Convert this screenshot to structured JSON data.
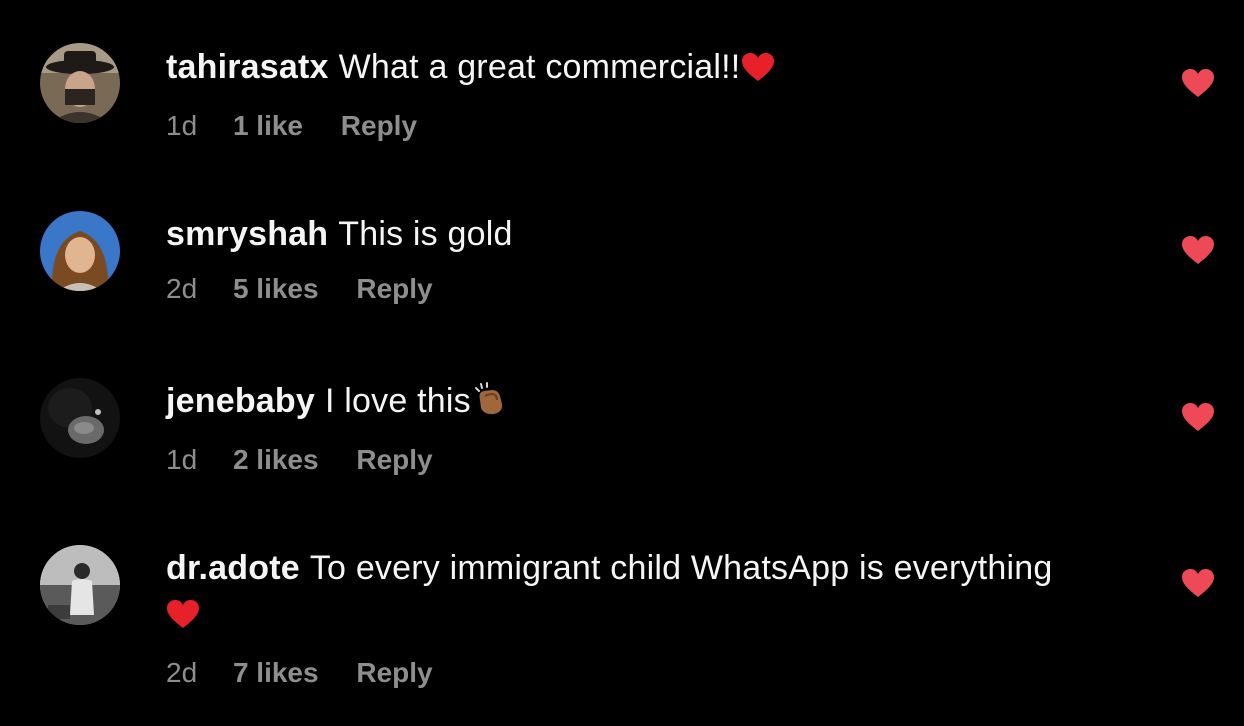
{
  "colors": {
    "background": "#000000",
    "text": "#f5f5f5",
    "meta": "#8e8e8e",
    "heart": "#ed4956"
  },
  "comments": [
    {
      "username": "tahirasatx",
      "text": "What a great commercial!!",
      "trailing_emoji": "red-heart",
      "time": "1d",
      "likes": "1 like",
      "reply": "Reply",
      "liked": true
    },
    {
      "username": "smryshah",
      "text": "This is gold",
      "time": "2d",
      "likes": "5 likes",
      "reply": "Reply",
      "liked": true
    },
    {
      "username": "jenebaby",
      "text": "I love this",
      "trailing_emoji": "clapping-hands",
      "time": "1d",
      "likes": "2 likes",
      "reply": "Reply",
      "liked": true
    },
    {
      "username": "dr.adote",
      "text": "To every immigrant child WhatsApp is everything",
      "trailing_emoji": "red-heart",
      "time": "2d",
      "likes": "7 likes",
      "reply": "Reply",
      "liked": true
    }
  ]
}
